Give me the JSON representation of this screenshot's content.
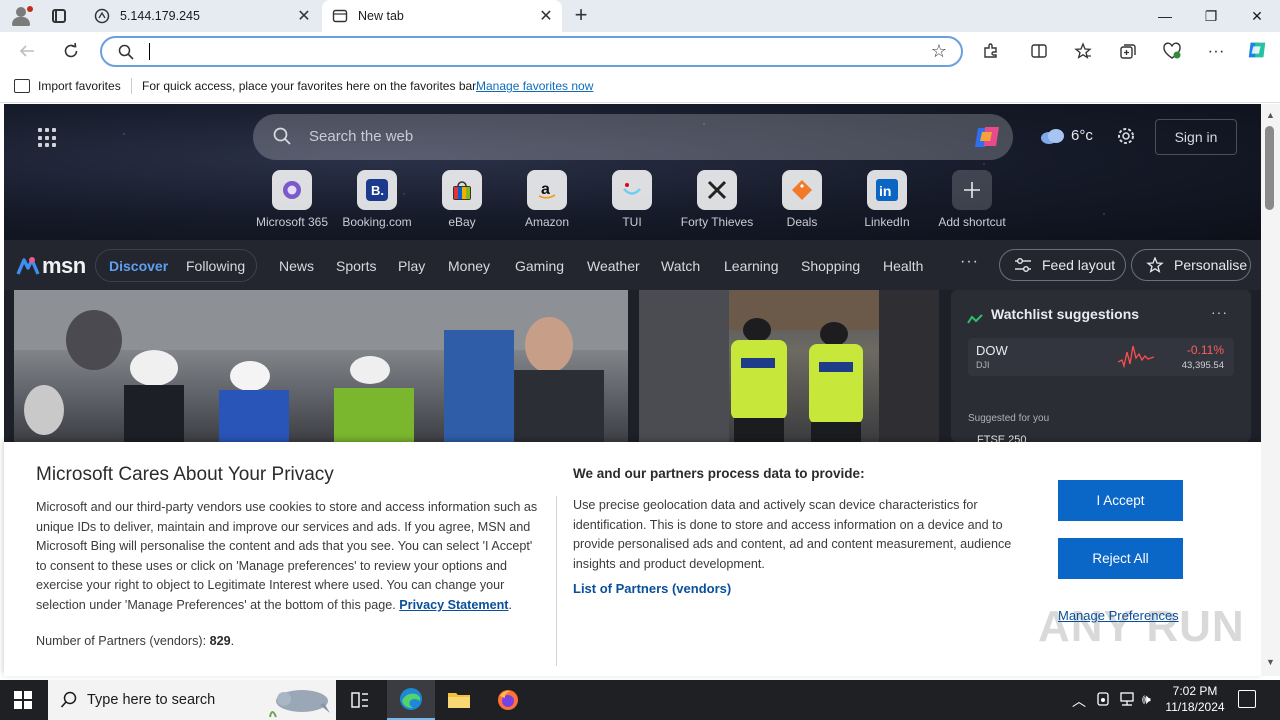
{
  "browser": {
    "tabs": [
      {
        "title": "5.144.179.245",
        "active": false
      },
      {
        "title": "New tab",
        "active": true
      }
    ],
    "address_bar": {
      "value": "",
      "placeholder": ""
    },
    "favorites_bar": {
      "import_label": "Import favorites",
      "message": "For quick access, place your favorites here on the favorites bar.",
      "link": "Manage favorites now"
    },
    "window_controls": {
      "minimize": "—",
      "maximize": "❐",
      "close": "✕"
    }
  },
  "msn": {
    "search_placeholder": "Search the web",
    "weather_temp": "6°c",
    "sign_in": "Sign in",
    "shortcuts": [
      {
        "label": "Microsoft 365",
        "icon": "microsoft-365-icon"
      },
      {
        "label": "Booking.com",
        "icon": "booking-icon"
      },
      {
        "label": "eBay",
        "icon": "ebay-icon"
      },
      {
        "label": "Amazon",
        "icon": "amazon-icon"
      },
      {
        "label": "TUI",
        "icon": "tui-icon"
      },
      {
        "label": "Forty Thieves",
        "icon": "forty-thieves-icon"
      },
      {
        "label": "Deals",
        "icon": "deals-icon"
      },
      {
        "label": "LinkedIn",
        "icon": "linkedin-icon"
      },
      {
        "label": "Add shortcut",
        "icon": "plus-icon"
      }
    ],
    "logo_text": "msn",
    "feed_tabs": {
      "discover": "Discover",
      "following": "Following"
    },
    "nav": [
      "News",
      "Sports",
      "Play",
      "Money",
      "Gaming",
      "Weather",
      "Watch",
      "Learning",
      "Shopping",
      "Health"
    ],
    "more": "···",
    "feed_layout": "Feed layout",
    "personalise": "Personalise",
    "watchlist": {
      "title": "Watchlist suggestions",
      "more": "···",
      "stock": {
        "symbol": "DOW",
        "exchange": "DJI",
        "change": "-0.11%",
        "value": "43,395.54"
      },
      "suggested_label": "Suggested for you",
      "next_symbol": "FTSE 250"
    }
  },
  "privacy": {
    "title": "Microsoft Cares About Your Privacy",
    "body": "Microsoft and our third-party vendors use cookies to store and access information such as unique IDs to deliver, maintain and improve our services and ads. If you agree, MSN and Microsoft Bing will personalise the content and ads that you see. You can select 'I Accept' to consent to these uses or click on 'Manage preferences' to review your options and exercise your right to object to Legitimate Interest where used.  You can change your selection under 'Manage Preferences' at the bottom of this page.",
    "privacy_link": "Privacy Statement",
    "partners_label": "Number of Partners (vendors):",
    "partners_count": "829",
    "data_title": "We and our partners process data to provide:",
    "data_body": "Use precise geolocation data and actively scan device characteristics for identification. This is done to store and access information on a device and to provide personalised ads and content, ad and content measurement, audience insights and product development.",
    "partners_link": "List of Partners (vendors)",
    "accept": "I Accept",
    "reject": "Reject All",
    "manage": "Manage Preferences",
    "watermark": "ANY RUN"
  },
  "taskbar": {
    "search_placeholder": "Type here to search",
    "time": "7:02 PM",
    "date": "11/18/2024"
  },
  "colors": {
    "accent": "#0a67c8",
    "msn_discover": "#5ea0ef",
    "address_border": "#6aa0de"
  }
}
